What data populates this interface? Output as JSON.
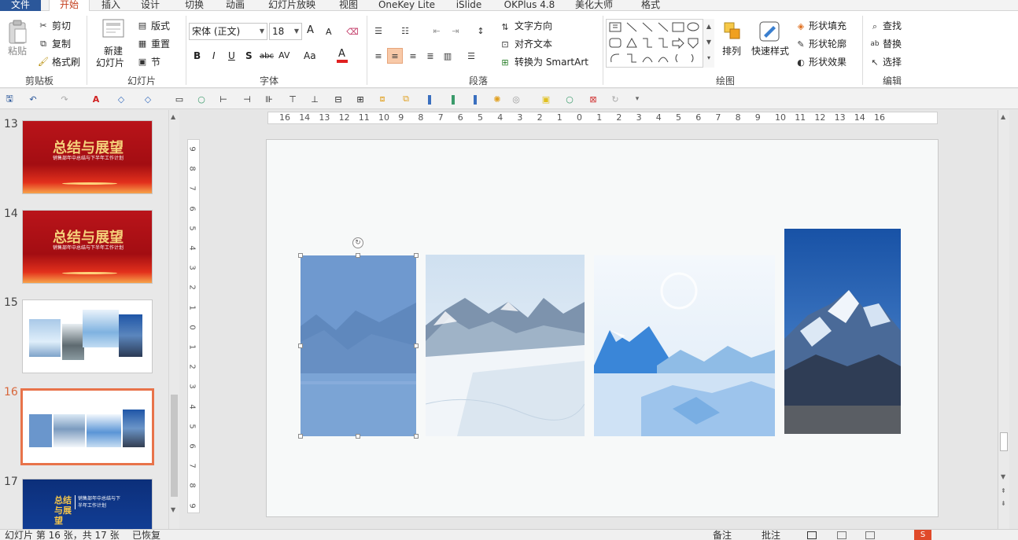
{
  "tabs": [
    "文件",
    "开始",
    "插入",
    "设计",
    "切换",
    "动画",
    "幻灯片放映",
    "视图",
    "OneKey Lite",
    "iSlide",
    "OKPlus 4.8",
    "美化大师",
    "格式"
  ],
  "active_tab": "开始",
  "ribbon": {
    "clipboard": {
      "label": "剪贴板",
      "paste": "粘贴",
      "cut": "剪切",
      "copy": "复制",
      "format_painter": "格式刷"
    },
    "slides": {
      "label": "幻灯片",
      "new_slide": "新建",
      "new_slide2": "幻灯片",
      "layout": "版式",
      "reset": "重置",
      "section": "节"
    },
    "font": {
      "label": "字体",
      "font_name": "宋体 (正文)",
      "font_size": "18",
      "bold": "B",
      "italic": "I",
      "underline": "U",
      "shadow": "S",
      "strike": "abc",
      "spacing": "AV",
      "case": "Aa",
      "color": "A",
      "grow": "A",
      "shrink": "A"
    },
    "paragraph": {
      "label": "段落",
      "text_direction": "文字方向",
      "align_text": "对齐文本",
      "convert_smartart": "转换为 SmartArt"
    },
    "drawing": {
      "label": "绘图",
      "arrange": "排列",
      "quick_styles": "快速样式",
      "shape_fill": "形状填充",
      "shape_outline": "形状轮廓",
      "shape_effects": "形状效果"
    },
    "editing": {
      "label": "编辑",
      "find": "查找",
      "replace": "替换",
      "select": "选择"
    }
  },
  "thumbnails": [
    {
      "num": "13",
      "title": "总结与展望",
      "subtitle": "销售部年中总结与下半年工作计划",
      "kind": "red"
    },
    {
      "num": "14",
      "title": "总结与展望",
      "subtitle": "销售部年中总结与下半年工作计划",
      "kind": "red"
    },
    {
      "num": "15",
      "kind": "photos"
    },
    {
      "num": "16",
      "kind": "photos-aligned",
      "selected": true
    },
    {
      "num": "17",
      "title": "总结与展望",
      "subtitle": "销售部年中总结与下半年工作计划",
      "kind": "blue"
    }
  ],
  "ruler_h": [
    "16",
    "14",
    "13",
    "12",
    "11",
    "10",
    "9",
    "8",
    "7",
    "6",
    "5",
    "4",
    "3",
    "2",
    "1",
    "0",
    "1",
    "2",
    "3",
    "4",
    "5",
    "6",
    "7",
    "8",
    "9",
    "10",
    "11",
    "12",
    "13",
    "14",
    "16"
  ],
  "ruler_v": [
    "9",
    "8",
    "7",
    "6",
    "5",
    "4",
    "3",
    "2",
    "1",
    "0",
    "1",
    "2",
    "3",
    "4",
    "5",
    "6",
    "7",
    "8",
    "9"
  ],
  "status": {
    "slide_info": "幻灯片 第 16 张，共 17 张",
    "recovered": "已恢复",
    "notes": "备注",
    "comments": "批注"
  },
  "colors": {
    "file_tab": "#2b579a",
    "active_tab_text": "#c43e1c",
    "selected_thumb_border": "#e8734a",
    "font_color_bar": "#e02020"
  }
}
